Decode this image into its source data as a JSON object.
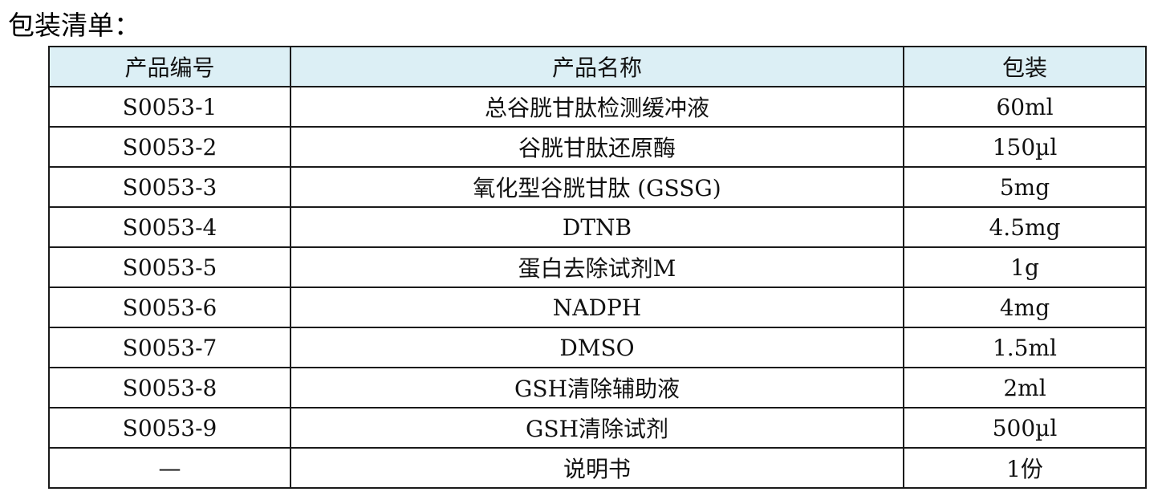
{
  "heading": "包装清单：",
  "table": {
    "headers": [
      "产品编号",
      "产品名称",
      "包装"
    ],
    "rows": [
      {
        "code": "S0053-1",
        "name": "总谷胱甘肽检测缓冲液",
        "pack": "60ml"
      },
      {
        "code": "S0053-2",
        "name": "谷胱甘肽还原酶",
        "pack": "150µl"
      },
      {
        "code": "S0053-3",
        "name": "氧化型谷胱甘肽 (GSSG)",
        "pack": "5mg"
      },
      {
        "code": "S0053-4",
        "name": "DTNB",
        "pack": "4.5mg"
      },
      {
        "code": "S0053-5",
        "name": "蛋白去除试剂M",
        "pack": "1g"
      },
      {
        "code": "S0053-6",
        "name": "NADPH",
        "pack": "4mg"
      },
      {
        "code": "S0053-7",
        "name": "DMSO",
        "pack": "1.5ml"
      },
      {
        "code": "S0053-8",
        "name": "GSH清除辅助液",
        "pack": "2ml"
      },
      {
        "code": "S0053-9",
        "name": "GSH清除试剂",
        "pack": "500µl"
      },
      {
        "code": "—",
        "name": "说明书",
        "pack": "1份"
      }
    ]
  },
  "colors": {
    "header_background": "#dceff5",
    "border": "#1a1a1a",
    "text": "#111111"
  }
}
